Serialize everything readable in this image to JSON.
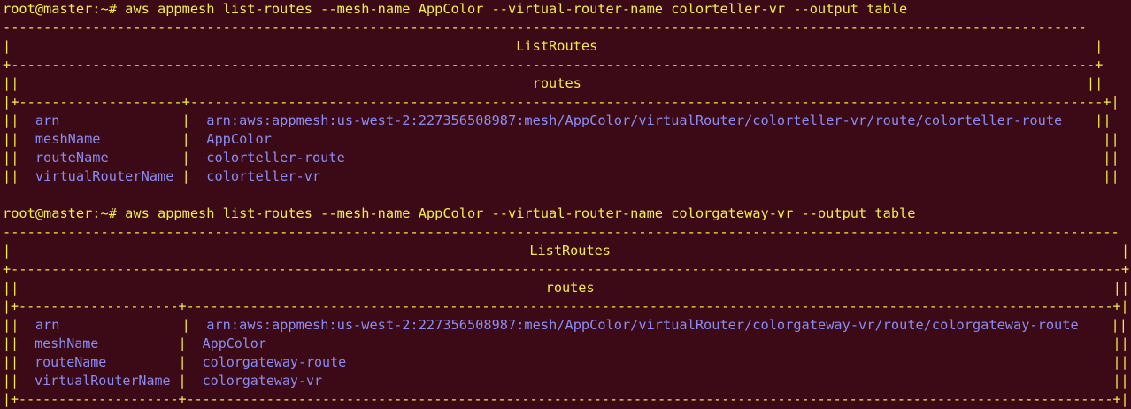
{
  "terminal": {
    "prompt": "root@master:~# ",
    "colors": {
      "background": "#3c0a16",
      "border_text": "#f2ec4a",
      "value_text": "#8a8cf2"
    }
  },
  "blocks": [
    {
      "command": "aws appmesh list-routes --mesh-name AppColor --virtual-router-name colorteller-vr --output table",
      "rule_top": "-------------------------------------------------------------------------------------------------------------------------------------",
      "title_line": "|                                                              ListRoutes                                                             |",
      "sep_1": "+-------------------------------------------------------------------------------------------------------------------------------------+",
      "routes_line": "||                                                               routes                                                              ||",
      "sep_2": "|+--------------------+----------------------------------------------------------------------------------------------------------------+|",
      "rows": [
        {
          "left": "||  ",
          "key": "arn",
          "mid": "               |  ",
          "value": "arn:aws:appmesh:us-west-2:227356508987:mesh/AppColor/virtualRouter/colorteller-vr/route/colorteller-route",
          "right": "    ||"
        },
        {
          "left": "||  ",
          "key": "meshName",
          "mid": "          |  ",
          "value": "AppColor",
          "right": "                                                                                                      ||"
        },
        {
          "left": "||  ",
          "key": "routeName",
          "mid": "         |  ",
          "value": "colorteller-route",
          "right": "                                                                                             ||"
        },
        {
          "left": "||  ",
          "key": "virtualRouterName",
          "mid": " |  ",
          "value": "colorteller-vr",
          "right": "                                                                                                ||"
        }
      ]
    },
    {
      "command": "aws appmesh list-routes --mesh-name AppColor --virtual-router-name colorgateway-vr --output table",
      "rule_top": "-----------------------------------------------------------------------------------------------------------------------------------------",
      "title_line": "|                                                                ListRoutes                                                               |",
      "sep_1": "+-----------------------------------------------------------------------------------------------------------------------------------------+",
      "routes_line": "||                                                                 routes                                                                ||",
      "sep_2": "|+--------------------+--------------------------------------------------------------------------------------------------------------------+|",
      "rows": [
        {
          "left": "||  ",
          "key": "arn",
          "mid": "               |  ",
          "value": "arn:aws:appmesh:us-west-2:227356508987:mesh/AppColor/virtualRouter/colorgateway-vr/route/colorgateway-route",
          "right": "    ||"
        },
        {
          "left": "||  ",
          "key": "meshName",
          "mid": "          |  ",
          "value": "AppColor",
          "right": "                                                                                                          ||"
        },
        {
          "left": "||  ",
          "key": "routeName",
          "mid": "         |  ",
          "value": "colorgateway-route",
          "right": "                                                                                                ||"
        },
        {
          "left": "||  ",
          "key": "virtualRouterName",
          "mid": " |  ",
          "value": "colorgateway-vr",
          "right": "                                                                                                   ||"
        }
      ],
      "rule_bottom": "|+--------------------+--------------------------------------------------------------------------------------------------------------------+|"
    }
  ]
}
